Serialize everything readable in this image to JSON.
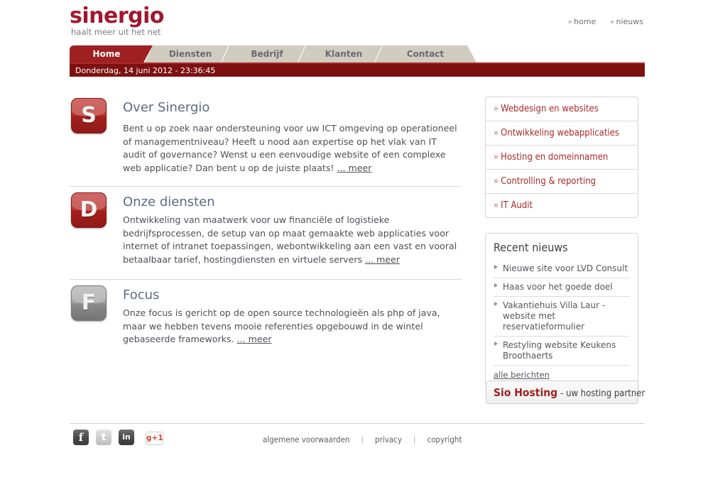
{
  "header": {
    "logo": "sinergio",
    "tagline": "haalt meer uit het net",
    "top_links": [
      {
        "label": "home",
        "chevron": "»"
      },
      {
        "label": "nieuws",
        "chevron": "»"
      }
    ]
  },
  "nav": {
    "tabs": [
      {
        "label": "Home",
        "active": true
      },
      {
        "label": "Diensten",
        "active": false
      },
      {
        "label": "Bedrijf",
        "active": false
      },
      {
        "label": "Klanten",
        "active": false
      },
      {
        "label": "Contact",
        "active": false
      }
    ],
    "active_color": "#9e2022",
    "inactive_bg": "#d1ccc0"
  },
  "datebar": {
    "text": "Donderdag, 14 juni 2012 - 23:36:45",
    "bg": "#7d1111"
  },
  "main": {
    "blocks": [
      {
        "badge_letter": "S",
        "badge_style": "red",
        "title": "Over Sinergio",
        "body": "Bent u op zoek naar ondersteuning voor uw ICT omgeving op operationeel of managementniveau? Heeft u nood aan expertise op het vlak van IT audit of governance? Wenst u een eenvoudige website of een complexe web applicatie? Dan bent u op de juiste plaats! ",
        "more": "... meer"
      },
      {
        "badge_letter": "D",
        "badge_style": "red",
        "title": "Onze diensten",
        "body": "Ontwikkeling van maatwerk voor uw financiële of logistieke bedrijfsprocessen, de setup van op maat gemaakte web applicaties voor internet of intranet toepassingen, webontwikkeling aan een vast en vooral betaalbaar tarief, hostingdiensten en virtuele servers ",
        "more": "... meer"
      },
      {
        "badge_letter": "F",
        "badge_style": "gray",
        "title": "Focus",
        "body": "Onze focus is gericht op de open source technologieën als php of java, maar we hebben tevens mooie referenties opgebouwd in de wintel gebaseerde frameworks. ",
        "more": "... meer"
      }
    ]
  },
  "sidebar": {
    "services": [
      {
        "chevron": "»",
        "label": "Webdesign en websites"
      },
      {
        "chevron": "»",
        "label": "Ontwikkeling webapplicaties"
      },
      {
        "chevron": "»",
        "label": "Hosting en domeinnamen"
      },
      {
        "chevron": "»",
        "label": "Controlling & reporting"
      },
      {
        "chevron": "»",
        "label": "IT Audit"
      }
    ],
    "link_color": "#a82a28",
    "news": {
      "title": "Recent nieuws",
      "items": [
        "Nieuwe site voor LVD Consult",
        "Haas voor het goede doel",
        "Vakantiehuis Villa Laur - website met reservatieformulier",
        "Restyling website Keukens Broothaerts"
      ],
      "all_label": "alle berichten"
    },
    "hosting_banner": {
      "brand": "Sio Hosting",
      "slogan": "- uw hosting partner"
    }
  },
  "footer": {
    "social": [
      {
        "name": "facebook",
        "glyph": "f"
      },
      {
        "name": "twitter",
        "glyph": "t"
      },
      {
        "name": "linkedin",
        "glyph": "in"
      },
      {
        "name": "google-plus-one",
        "glyph": "g+1"
      }
    ],
    "links": [
      {
        "label": "algemene voorwaarden"
      },
      {
        "label": "privacy"
      },
      {
        "label": "copyright"
      }
    ],
    "separator": "|"
  }
}
